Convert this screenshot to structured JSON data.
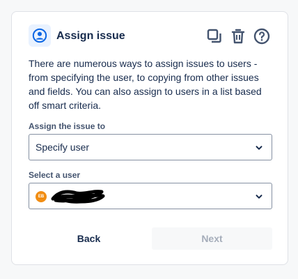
{
  "header": {
    "title": "Assign issue",
    "actions": [
      {
        "icon": "duplicate-icon"
      },
      {
        "icon": "trash-icon"
      },
      {
        "icon": "help-icon"
      }
    ]
  },
  "description": "There are numerous ways to assign issues to users - from specifying the user, to copying from other issues and fields. You can also assign to users in a list based off smart criteria.",
  "assign_field": {
    "label": "Assign the issue to",
    "value": "Specify user"
  },
  "user_field": {
    "label": "Select a user",
    "avatar_initials": "EB",
    "avatar_color": "#f18d13"
  },
  "buttons": {
    "back_label": "Back",
    "next_label": "Next"
  },
  "colors": {
    "icon_blue": "#0c66e4",
    "text": "#172b4d",
    "disabled_text": "#a5adba"
  }
}
